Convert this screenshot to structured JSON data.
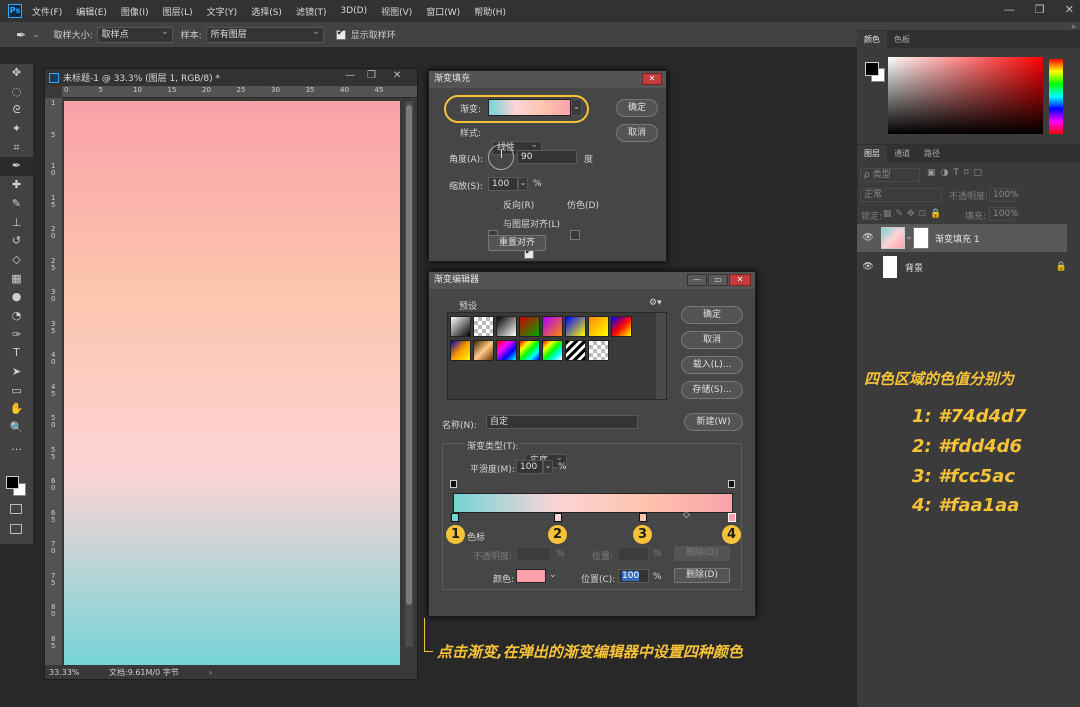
{
  "app": {
    "logo": "Ps",
    "menu": [
      "文件(F)",
      "编辑(E)",
      "图像(I)",
      "图层(L)",
      "文字(Y)",
      "选择(S)",
      "滤镜(T)",
      "3D(D)",
      "视图(V)",
      "窗口(W)",
      "帮助(H)"
    ],
    "window_controls": [
      "—",
      "❐",
      "✕"
    ]
  },
  "options_bar": {
    "tool_icon": "eyedropper-icon",
    "sample_size_label": "取样大小:",
    "sample_size_value": "取样点",
    "sample_label": "样本:",
    "sample_value": "所有图层",
    "show_ring_label": "显示取样环",
    "show_ring_checked": true
  },
  "toolbar": {
    "tools": [
      "move-icon",
      "marquee-icon",
      "lasso-icon",
      "magic-wand-icon",
      "crop-icon",
      "eyedropper-icon",
      "healing-icon",
      "brush-icon",
      "stamp-icon",
      "history-brush-icon",
      "eraser-icon",
      "gradient-icon",
      "blur-icon",
      "dodge-icon",
      "pen-icon",
      "type-icon",
      "path-select-icon",
      "shape-icon",
      "hand-icon",
      "zoom-icon",
      "more-icon"
    ],
    "glyphs": [
      "✥",
      "◌",
      "ᘓ",
      "✦",
      "⌗",
      "✒",
      "✚",
      "✎",
      "⊥",
      "↺",
      "◇",
      "▦",
      "●",
      "◔",
      "✑",
      "T",
      "➤",
      "▭",
      "✋",
      "🔍",
      "…"
    ]
  },
  "document": {
    "title": "未标题-1 @ 33.3% (图层 1, RGB/8) *",
    "ruler_top": [
      "0",
      "5",
      "10",
      "15",
      "20",
      "25",
      "30",
      "35",
      "40",
      "45"
    ],
    "ruler_left": [
      "1",
      "5",
      "1\n0",
      "1\n5",
      "2\n0",
      "2\n5",
      "3\n0",
      "3\n5",
      "4\n0",
      "4\n5",
      "5\n0",
      "5\n5",
      "6\n0",
      "6\n5",
      "7\n0",
      "7\n5",
      "8\n0",
      "8\n5"
    ],
    "zoom": "33.33%",
    "doc_info": "文档:9.61M/0 字节",
    "gradient_colors": [
      "#faa1aa",
      "#fcc5ac",
      "#fdd4d6",
      "#74d4d7"
    ]
  },
  "gradient_fill_dialog": {
    "title": "渐变填充",
    "gradient_label": "渐变:",
    "style_label": "样式:",
    "style_value": "线性",
    "angle_label": "角度(A):",
    "angle_value": "90",
    "angle_unit": "度",
    "scale_label": "缩放(S):",
    "scale_value": "100",
    "scale_unit": "%",
    "reverse_label": "反向(R)",
    "reverse_checked": false,
    "dither_label": "仿色(D)",
    "dither_checked": false,
    "align_label": "与图层对齐(L)",
    "align_checked": true,
    "reset_label": "重置对齐",
    "ok_label": "确定",
    "cancel_label": "取消"
  },
  "gradient_editor": {
    "title": "渐变编辑器",
    "presets_label": "预设",
    "ok_label": "确定",
    "cancel_label": "取消",
    "load_label": "载入(L)...",
    "save_label": "存储(S)...",
    "name_label": "名称(N):",
    "name_value": "自定",
    "new_label": "新建(W)",
    "type_label": "渐变类型(T):",
    "type_value": "实底",
    "smooth_label": "平滑度(M):",
    "smooth_value": "100",
    "smooth_unit": "%",
    "stops_label": "色标",
    "opacity_label": "不透明度:",
    "location_label": "位置:",
    "delete_label": "删除(D)",
    "color_label": "颜色:",
    "location_c_label": "位置(C):",
    "location_value": "100",
    "percent": "%",
    "stop_color": "#faa1aa",
    "stop_numbers": [
      "1",
      "2",
      "3",
      "4"
    ],
    "stop_colors": [
      "#74d4d7",
      "#fdd4d6",
      "#fcc5ac",
      "#faa1aa"
    ]
  },
  "right_panel": {
    "color_tabs": [
      "颜色",
      "色板"
    ],
    "layer_tabs": [
      "图层",
      "通道",
      "路径"
    ],
    "kind_label": "ρ 类型",
    "blend_mode": "正常",
    "opacity_label": "不透明度:",
    "opacity_value": "100%",
    "lock_label": "锁定:",
    "fill_label": "填充:",
    "fill_value": "100%",
    "layers": [
      {
        "name": "渐变填充 1"
      },
      {
        "name": "背景"
      }
    ]
  },
  "annotations": {
    "colors_title": "四色区域的色值分别为",
    "colors": [
      "1: #74d4d7",
      "2: #fdd4d6",
      "3: #fcc5ac",
      "4: #faa1aa"
    ],
    "bottom_note": "点击渐变,在弹出的渐变编辑器中设置四种颜色"
  }
}
